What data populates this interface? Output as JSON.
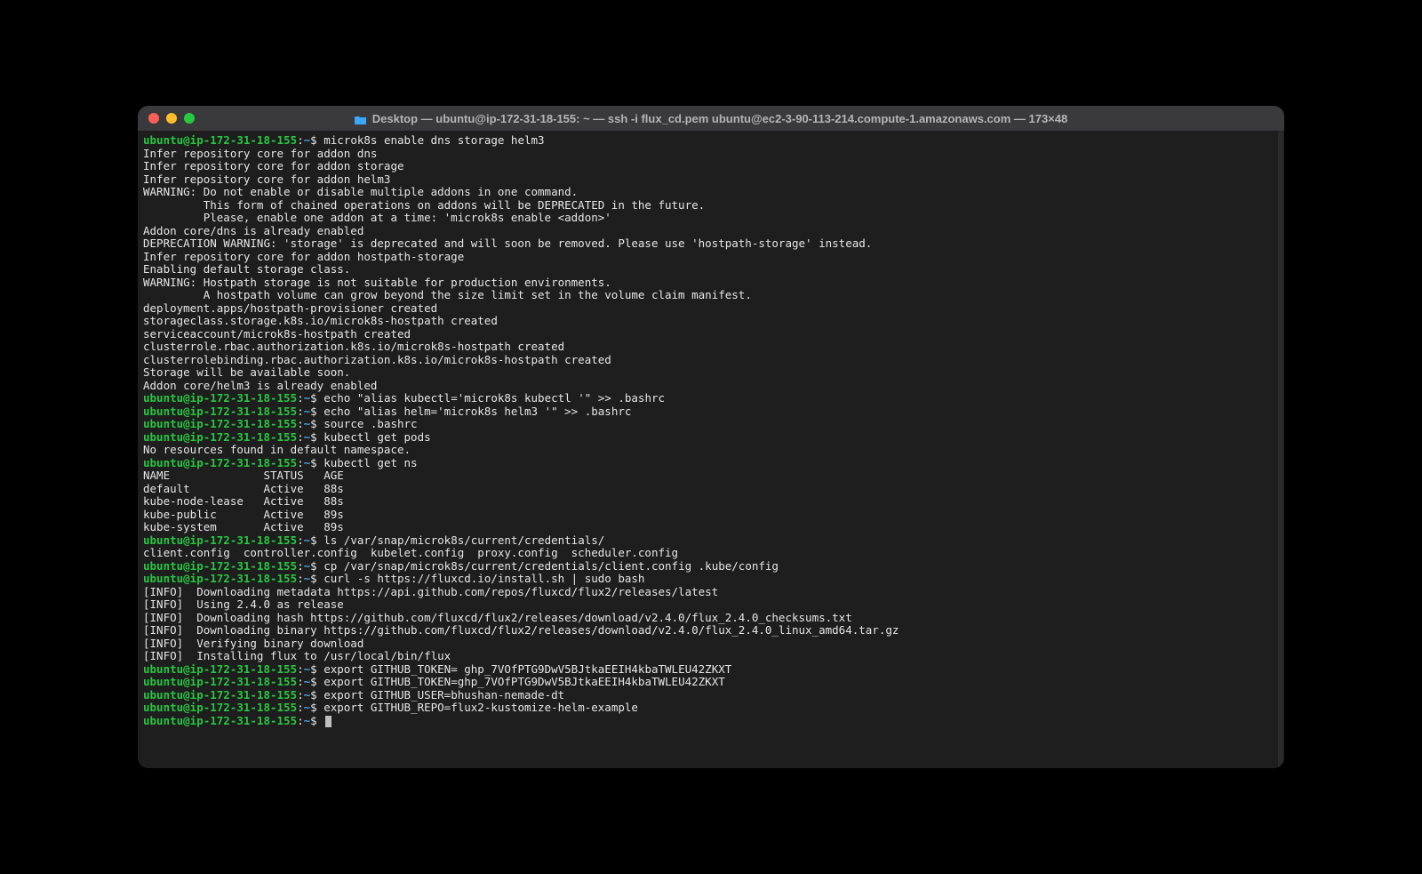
{
  "window": {
    "title": "Desktop — ubuntu@ip-172-31-18-155: ~ — ssh -i flux_cd.pem ubuntu@ec2-3-90-113-214.compute-1.amazonaws.com — 173×48"
  },
  "prompt": {
    "user_host": "ubuntu@ip-172-31-18-155",
    "sep": ":",
    "path": "~",
    "symbol": "$"
  },
  "session": [
    {
      "type": "cmd",
      "text": "microk8s enable dns storage helm3"
    },
    {
      "type": "out",
      "text": "Infer repository core for addon dns"
    },
    {
      "type": "out",
      "text": "Infer repository core for addon storage"
    },
    {
      "type": "out",
      "text": "Infer repository core for addon helm3"
    },
    {
      "type": "out",
      "text": "WARNING: Do not enable or disable multiple addons in one command."
    },
    {
      "type": "out",
      "text": "         This form of chained operations on addons will be DEPRECATED in the future."
    },
    {
      "type": "out",
      "text": "         Please, enable one addon at a time: 'microk8s enable <addon>'"
    },
    {
      "type": "out",
      "text": "Addon core/dns is already enabled"
    },
    {
      "type": "out",
      "text": "DEPRECATION WARNING: 'storage' is deprecated and will soon be removed. Please use 'hostpath-storage' instead."
    },
    {
      "type": "out",
      "text": ""
    },
    {
      "type": "out",
      "text": "Infer repository core for addon hostpath-storage"
    },
    {
      "type": "out",
      "text": "Enabling default storage class."
    },
    {
      "type": "out",
      "text": "WARNING: Hostpath storage is not suitable for production environments."
    },
    {
      "type": "out",
      "text": "         A hostpath volume can grow beyond the size limit set in the volume claim manifest."
    },
    {
      "type": "out",
      "text": ""
    },
    {
      "type": "out",
      "text": "deployment.apps/hostpath-provisioner created"
    },
    {
      "type": "out",
      "text": "storageclass.storage.k8s.io/microk8s-hostpath created"
    },
    {
      "type": "out",
      "text": "serviceaccount/microk8s-hostpath created"
    },
    {
      "type": "out",
      "text": "clusterrole.rbac.authorization.k8s.io/microk8s-hostpath created"
    },
    {
      "type": "out",
      "text": "clusterrolebinding.rbac.authorization.k8s.io/microk8s-hostpath created"
    },
    {
      "type": "out",
      "text": "Storage will be available soon."
    },
    {
      "type": "out",
      "text": "Addon core/helm3 is already enabled"
    },
    {
      "type": "cmd",
      "text": "echo \"alias kubectl='microk8s kubectl '\" >> .bashrc"
    },
    {
      "type": "cmd",
      "text": "echo \"alias helm='microk8s helm3 '\" >> .bashrc"
    },
    {
      "type": "cmd",
      "text": "source .bashrc"
    },
    {
      "type": "cmd",
      "text": "kubectl get pods"
    },
    {
      "type": "out",
      "text": "No resources found in default namespace."
    },
    {
      "type": "cmd",
      "text": "kubectl get ns"
    },
    {
      "type": "out",
      "text": "NAME              STATUS   AGE"
    },
    {
      "type": "out",
      "text": "default           Active   88s"
    },
    {
      "type": "out",
      "text": "kube-node-lease   Active   88s"
    },
    {
      "type": "out",
      "text": "kube-public       Active   89s"
    },
    {
      "type": "out",
      "text": "kube-system       Active   89s"
    },
    {
      "type": "cmd",
      "text": "ls /var/snap/microk8s/current/credentials/"
    },
    {
      "type": "out",
      "text": "client.config  controller.config  kubelet.config  proxy.config  scheduler.config"
    },
    {
      "type": "cmd",
      "text": "cp /var/snap/microk8s/current/credentials/client.config .kube/config"
    },
    {
      "type": "cmd",
      "text": "curl -s https://fluxcd.io/install.sh | sudo bash"
    },
    {
      "type": "out",
      "text": "[INFO]  Downloading metadata https://api.github.com/repos/fluxcd/flux2/releases/latest"
    },
    {
      "type": "out",
      "text": "[INFO]  Using 2.4.0 as release"
    },
    {
      "type": "out",
      "text": "[INFO]  Downloading hash https://github.com/fluxcd/flux2/releases/download/v2.4.0/flux_2.4.0_checksums.txt"
    },
    {
      "type": "out",
      "text": "[INFO]  Downloading binary https://github.com/fluxcd/flux2/releases/download/v2.4.0/flux_2.4.0_linux_amd64.tar.gz"
    },
    {
      "type": "out",
      "text": "[INFO]  Verifying binary download"
    },
    {
      "type": "out",
      "text": "[INFO]  Installing flux to /usr/local/bin/flux"
    },
    {
      "type": "cmd",
      "text": "export GITHUB_TOKEN= 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"
    },
    {
      "type": "cmd",
      "text": "export GITHUB_TOKEN=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"
    },
    {
      "type": "cmd",
      "text": "export GITHUB_USER=bhushan-nemade-dt"
    },
    {
      "type": "cmd",
      "text": "export GITHUB_REPO=flux2-kustomize-helm-example"
    },
    {
      "type": "cursor"
    }
  ]
}
